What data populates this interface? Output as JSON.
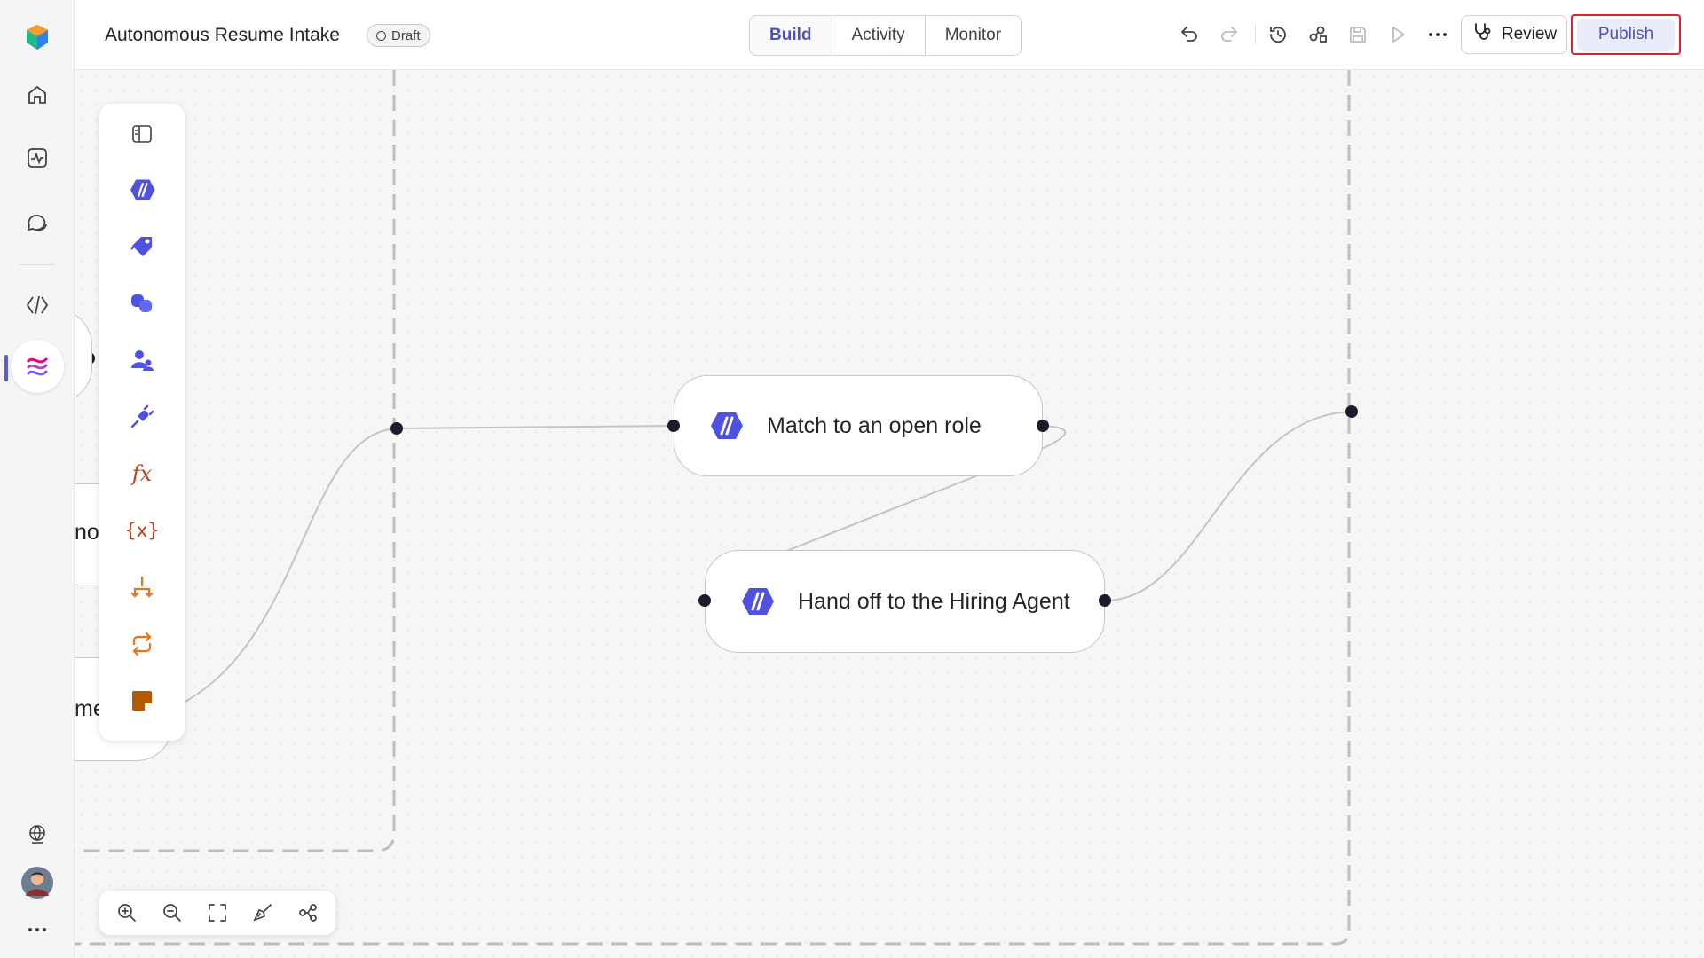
{
  "app": {
    "title": "Autonomous Resume Intake",
    "status_badge": "Draft"
  },
  "tabs": [
    {
      "label": "Build",
      "active": true
    },
    {
      "label": "Activity",
      "active": false
    },
    {
      "label": "Monitor",
      "active": false
    }
  ],
  "toolbar": {
    "review_label": "Review",
    "publish_label": "Publish",
    "icons": [
      "undo-icon",
      "redo-icon",
      "history-icon",
      "connections-icon",
      "save-icon",
      "run-icon",
      "more-icon"
    ]
  },
  "rail": {
    "items": [
      "home-icon",
      "activity-icon",
      "chat-icon",
      "code-icon",
      "flows-icon"
    ],
    "bottom": [
      "globe-icon",
      "user-avatar",
      "more-icon"
    ]
  },
  "palette": {
    "items": [
      "panel-toggle-icon",
      "agent-icon",
      "tag-icon",
      "copilot-icon",
      "people-icon",
      "connector-icon",
      "fx-icon",
      "variable-icon",
      "branch-icon",
      "loop-icon",
      "note-icon"
    ]
  },
  "nodes": [
    {
      "label": "Match to an open role"
    },
    {
      "label": "Hand off to the Hiring Agent"
    }
  ],
  "partial_nodes": [
    "no",
    "me"
  ],
  "zoom_controls": [
    "zoom-in-icon",
    "zoom-out-icon",
    "fit-view-icon",
    "clean-up-icon",
    "layout-icon"
  ],
  "colors": {
    "accent": "#4f52b2",
    "agent_icon": "#4f52e0",
    "fx_red": "#c43e1c",
    "orange": "#e8751a",
    "publish_highlight": "#d9232f"
  }
}
